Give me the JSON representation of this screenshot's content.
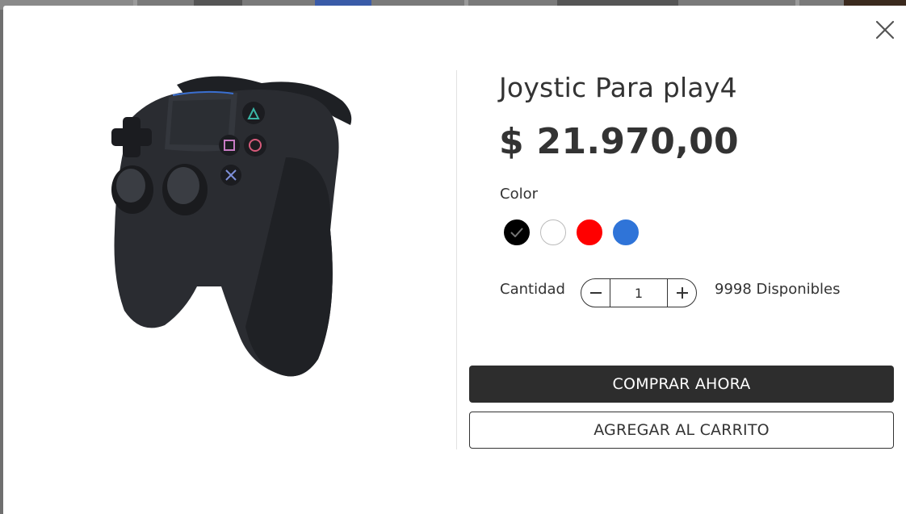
{
  "product": {
    "title": "Joystic Para play4",
    "price": "$ 21.970,00",
    "image_alt": "gamepad-controller"
  },
  "color": {
    "label": "Color",
    "options": [
      {
        "name": "black",
        "hex": "#000000",
        "selected": true
      },
      {
        "name": "white",
        "hex": "#ffffff",
        "selected": false
      },
      {
        "name": "red",
        "hex": "#ff0000",
        "selected": false
      },
      {
        "name": "blue",
        "hex": "#2f74d8",
        "selected": false
      }
    ]
  },
  "quantity": {
    "label": "Cantidad",
    "value": "1",
    "available": "9998 Disponibles"
  },
  "actions": {
    "buy_now": "COMPRAR AHORA",
    "add_to_cart": "AGREGAR AL CARRITO"
  },
  "colors": {
    "primary_button": "#2d2d2d",
    "text": "#333333"
  }
}
